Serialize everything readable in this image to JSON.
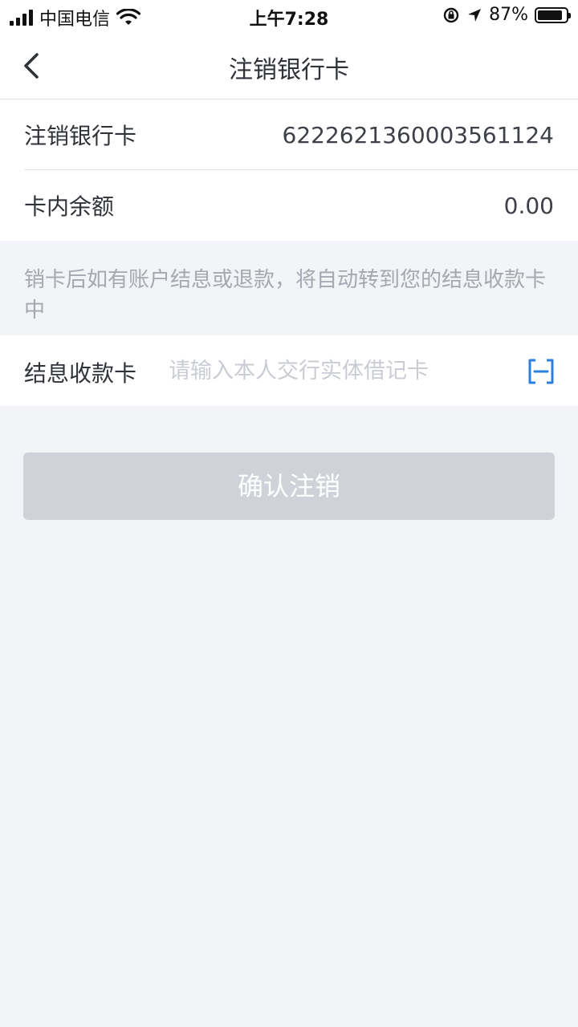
{
  "status_bar": {
    "carrier": "中国电信",
    "time": "上午7:28",
    "battery_percent": "87%",
    "battery_level": 0.87,
    "icons": [
      "signal-icon",
      "wifi-icon",
      "rotation-lock-icon",
      "location-arrow-icon",
      "battery-icon"
    ]
  },
  "nav": {
    "title": "注销银行卡",
    "back_icon": "chevron-left-icon"
  },
  "card_info": {
    "rows": [
      {
        "label": "注销银行卡",
        "value": "6222621360003561124"
      },
      {
        "label": "卡内余额",
        "value": "0.00"
      }
    ]
  },
  "notice": {
    "text": "销卡后如有账户结息或退款，将自动转到您的结息收款卡中"
  },
  "interest_card": {
    "label": "结息收款卡",
    "placeholder": "请输入本人交行实体借记卡",
    "value": "",
    "scan_icon": "scan-icon",
    "scan_color": "#2b7fe0"
  },
  "actions": {
    "confirm_label": "确认注销",
    "confirm_color": "#cfd3d9"
  },
  "colors": {
    "background": "#f3f4f8",
    "text_primary": "#2f3338",
    "text_muted": "#a4a8b0"
  }
}
